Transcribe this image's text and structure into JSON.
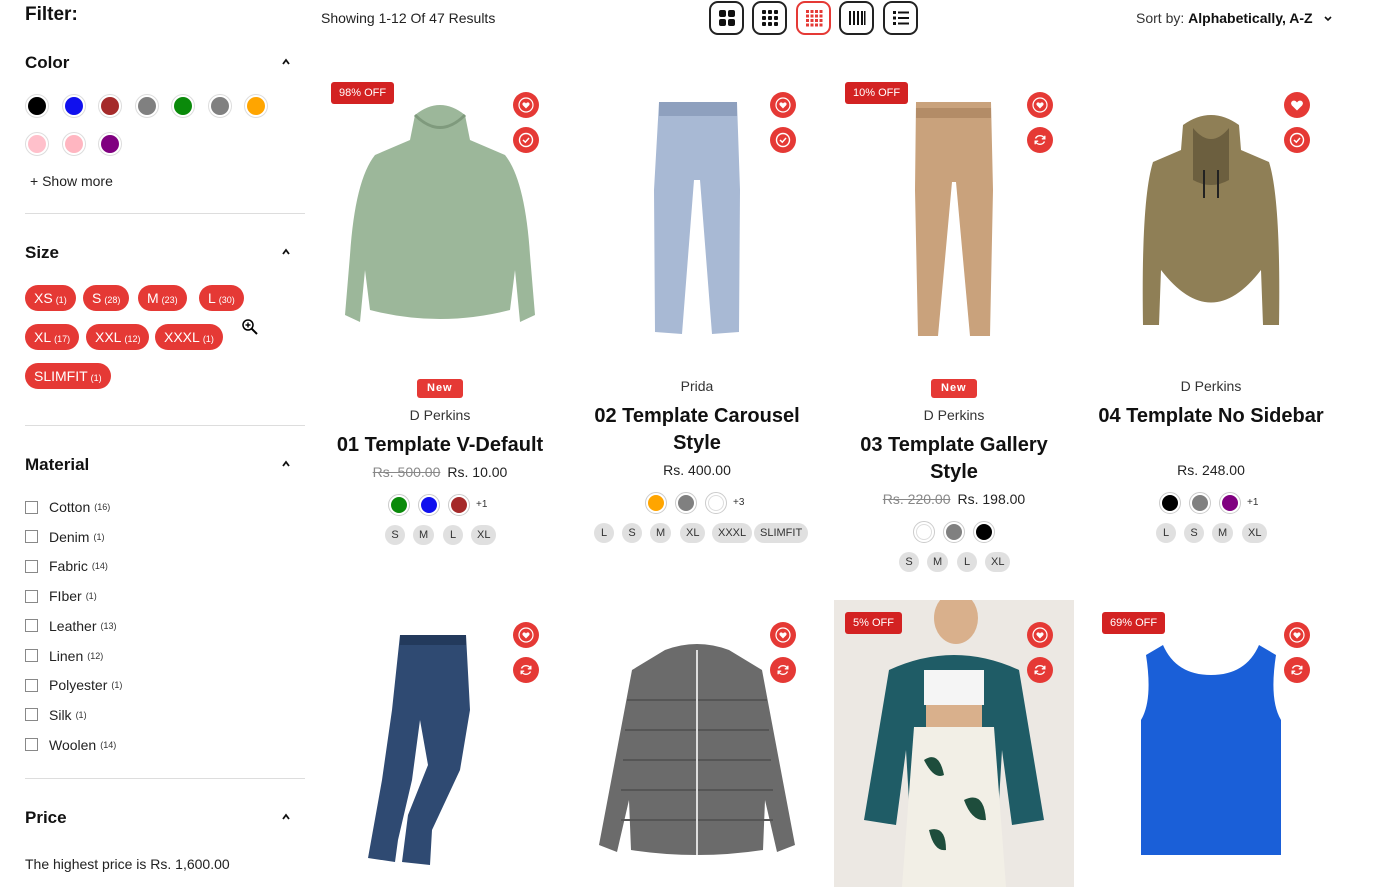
{
  "sidebar": {
    "filter_title": "Filter:",
    "color": {
      "title": "Color",
      "swatches": [
        "#000000",
        "#1010ee",
        "#a52a2a",
        "#808080",
        "#0a8a0a",
        "#808080",
        "#ffa500",
        "#ffc0cb",
        "#ffb6c1",
        "#800080"
      ],
      "show_more": "+ Show more"
    },
    "size": {
      "title": "Size",
      "pills": [
        {
          "label": "XS",
          "count": "(1)"
        },
        {
          "label": "S",
          "count": "(28)"
        },
        {
          "label": "M",
          "count": "(23)"
        },
        {
          "label": "L",
          "count": "(30)"
        },
        {
          "label": "XL",
          "count": "(17)"
        },
        {
          "label": "XXL",
          "count": "(12)"
        },
        {
          "label": "XXXL",
          "count": "(1)"
        },
        {
          "label": "SLIMFIT",
          "count": "(1)"
        }
      ]
    },
    "material": {
      "title": "Material",
      "items": [
        {
          "label": "Cotton",
          "count": "(16)"
        },
        {
          "label": "Denim",
          "count": "(1)"
        },
        {
          "label": "Fabric",
          "count": "(14)"
        },
        {
          "label": "FIber",
          "count": "(1)"
        },
        {
          "label": "Leather",
          "count": "(13)"
        },
        {
          "label": "Linen",
          "count": "(12)"
        },
        {
          "label": "Polyester",
          "count": "(1)"
        },
        {
          "label": "Silk",
          "count": "(1)"
        },
        {
          "label": "Woolen",
          "count": "(14)"
        }
      ]
    },
    "price": {
      "title": "Price",
      "highest": "The highest price is Rs. 1,600.00"
    }
  },
  "toolbar": {
    "results": "Showing 1-12 Of 47 Results",
    "sort_label": "Sort by:",
    "sort_value": "Alphabetically, A-Z",
    "views": [
      "grid-2",
      "grid-3",
      "grid-4",
      "grid-5",
      "list"
    ],
    "active_view": "grid-4"
  },
  "accent": "#e53935",
  "products": [
    {
      "badge": "98% OFF",
      "new": "New",
      "vendor": "D Perkins",
      "name": "01 Template V-Default",
      "old_price": "Rs. 500.00",
      "price": "Rs. 10.00",
      "colors": [
        "#0a8a0a",
        "#1010ee",
        "#a52a2a"
      ],
      "more_colors": "+1",
      "sizes": [
        "S",
        "M",
        "L",
        "XL"
      ],
      "second_icon": "check-icon"
    },
    {
      "badge": "",
      "new": "",
      "vendor": "Prida",
      "name": "02 Template Carousel Style",
      "old_price": "",
      "price": "Rs. 400.00",
      "colors": [
        "#ffa500",
        "#808080",
        "#ffffff"
      ],
      "more_colors": "+3",
      "sizes": [
        "L",
        "S",
        "M",
        "XL",
        "XXXL",
        "SLIMFIT"
      ],
      "second_icon": "check-icon"
    },
    {
      "badge": "10% OFF",
      "new": "New",
      "vendor": "D Perkins",
      "name": "03 Template Gallery Style",
      "old_price": "Rs. 220.00",
      "price": "Rs. 198.00",
      "colors": [
        "#ffffff",
        "#808080",
        "#000000"
      ],
      "more_colors": "",
      "sizes": [
        "S",
        "M",
        "L",
        "XL"
      ],
      "second_icon": "refresh-icon"
    },
    {
      "badge": "",
      "new": "",
      "vendor": "D Perkins",
      "name": "04 Template No Sidebar",
      "old_price": "",
      "price": "Rs. 248.00",
      "colors": [
        "#000000",
        "#808080",
        "#800080"
      ],
      "more_colors": "+1",
      "sizes": [
        "L",
        "S",
        "M",
        "XL"
      ],
      "second_icon": "check-icon"
    },
    {
      "badge": "",
      "second_icon": "refresh-icon"
    },
    {
      "badge": "",
      "second_icon": "refresh-icon"
    },
    {
      "badge": "5% OFF",
      "second_icon": "refresh-icon"
    },
    {
      "badge": "69% OFF",
      "second_icon": "refresh-icon"
    }
  ]
}
